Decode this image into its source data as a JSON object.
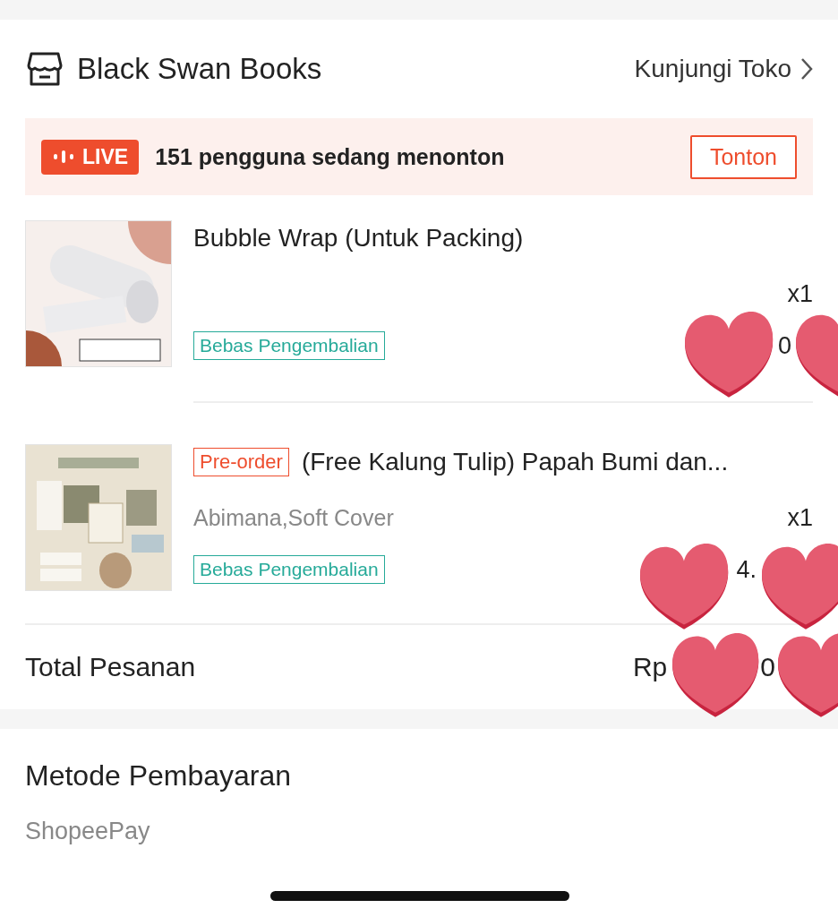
{
  "shop": {
    "name": "Black Swan Books",
    "visit_link": "Kunjungi Toko"
  },
  "live": {
    "badge": "LIVE",
    "viewers": "151 pengguna sedang menonton",
    "button": "Tonton"
  },
  "items": [
    {
      "title": "Bubble Wrap (Untuk Packing)",
      "quantity": "x1",
      "return_badge": "Bebas Pengembalian",
      "price_visible": "0"
    },
    {
      "tag": "Pre-order",
      "title": "(Free Kalung Tulip) Papah Bumi dan...",
      "variant": "Abimana,Soft Cover",
      "quantity": "x1",
      "return_badge": "Bebas Pengembalian",
      "price_visible": "4."
    }
  ],
  "total": {
    "label": "Total Pesanan",
    "value_parts": [
      "Rp",
      "0"
    ]
  },
  "payment": {
    "title": "Metode Pembayaran",
    "method": "ShopeePay"
  }
}
